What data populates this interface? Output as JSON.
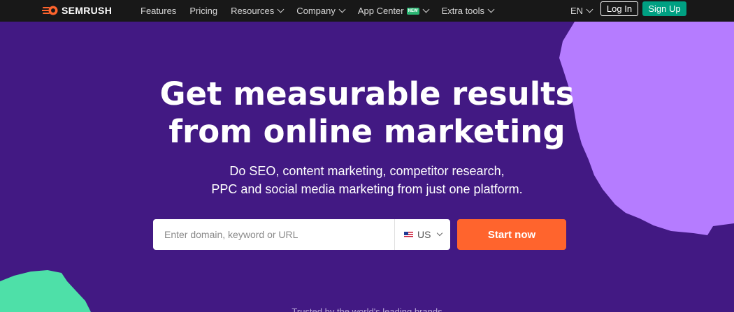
{
  "nav": {
    "logo_text": "SEMRUSH",
    "items": [
      {
        "label": "Features"
      },
      {
        "label": "Pricing"
      },
      {
        "label": "Resources"
      },
      {
        "label": "Company"
      },
      {
        "label": "App Center",
        "badge": "NEW"
      },
      {
        "label": "Extra tools"
      }
    ],
    "language": "EN",
    "login_label": "Log In",
    "signup_label": "Sign Up"
  },
  "hero": {
    "headline_line1": "Get measurable results",
    "headline_line2": "from online marketing",
    "subheadline_line1": "Do SEO, content marketing, competitor research,",
    "subheadline_line2": "PPC and social media marketing from just one platform."
  },
  "search": {
    "placeholder": "Enter domain, keyword or URL",
    "value": "",
    "database": "US",
    "submit_label": "Start now"
  },
  "trusted_text": "Trusted by the world's leading brands",
  "colors": {
    "background": "#421983",
    "nav_background": "#181818",
    "accent_orange": "#ff642d",
    "signup_green": "#00a082",
    "decor_purple": "#b57cff",
    "decor_green": "#4ee0a8",
    "new_badge": "#2bb673"
  },
  "icons": {
    "logo": "semrush-fireball-icon",
    "dropdown": "chevron-down-icon",
    "flag": "us-flag-icon"
  }
}
